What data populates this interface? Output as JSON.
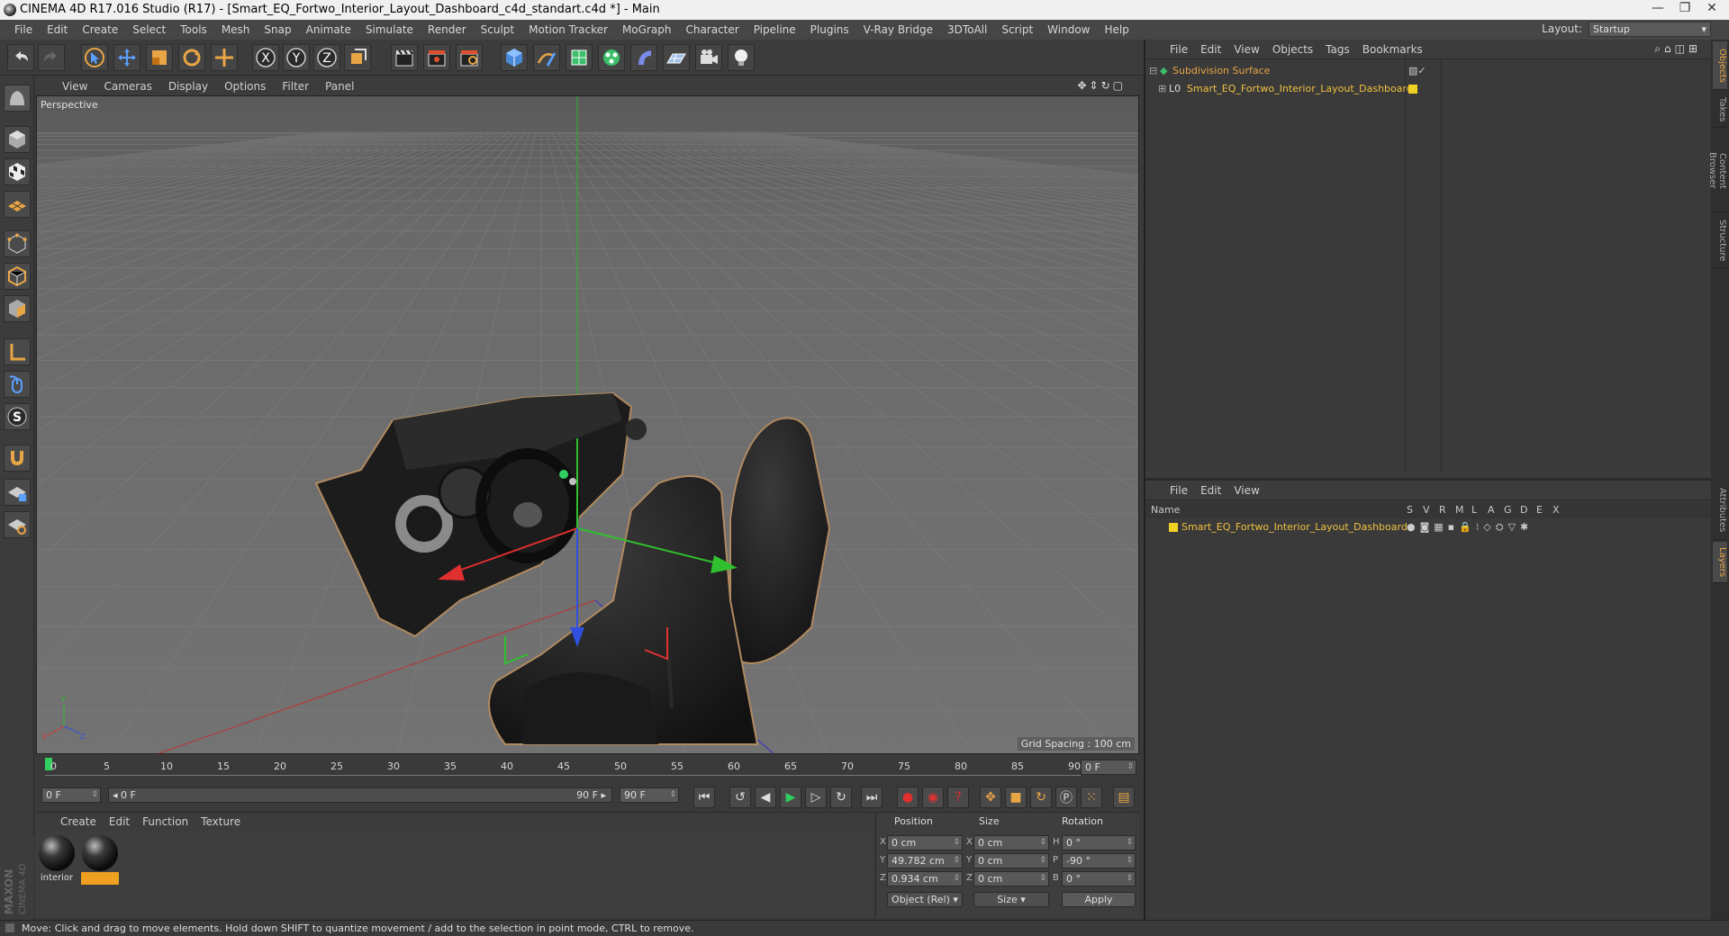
{
  "window": {
    "title": "CINEMA 4D R17.016 Studio (R17) - [Smart_EQ_Fortwo_Interior_Layout_Dashboard_c4d_standart.c4d *] - Main",
    "minimize": "—",
    "maximize": "❐",
    "close": "✕"
  },
  "menu": [
    "File",
    "Edit",
    "Create",
    "Select",
    "Tools",
    "Mesh",
    "Snap",
    "Animate",
    "Simulate",
    "Render",
    "Sculpt",
    "Motion Tracker",
    "MoGraph",
    "Character",
    "Pipeline",
    "Plugins",
    "V-Ray Bridge",
    "3DToAll",
    "Script",
    "Window",
    "Help"
  ],
  "layout": {
    "label": "Layout:",
    "value": "Startup"
  },
  "viewport": {
    "menu": [
      "View",
      "Cameras",
      "Display",
      "Options",
      "Filter",
      "Panel"
    ],
    "label": "Perspective",
    "grid_spacing": "Grid Spacing : 100 cm"
  },
  "timeline": {
    "ticks": [
      "0",
      "5",
      "10",
      "15",
      "20",
      "25",
      "30",
      "35",
      "40",
      "45",
      "50",
      "55",
      "60",
      "65",
      "70",
      "75",
      "80",
      "85",
      "90"
    ],
    "current_frame": "0 F"
  },
  "anim": {
    "start": "0 F",
    "range_start": "◂ 0 F",
    "range_end": "90 F ▸",
    "end": "90 F"
  },
  "materials": {
    "menu": [
      "Create",
      "Edit",
      "Function",
      "Texture"
    ],
    "items": [
      {
        "label": "interior"
      },
      {
        "label": ""
      }
    ]
  },
  "coords": {
    "headers": {
      "position": "Position",
      "size": "Size",
      "rotation": "Rotation"
    },
    "position": [
      {
        "axis": "X",
        "value": "0 cm"
      },
      {
        "axis": "Y",
        "value": "49.782 cm"
      },
      {
        "axis": "Z",
        "value": "0.934 cm"
      }
    ],
    "size": [
      {
        "axis": "X",
        "value": "0 cm"
      },
      {
        "axis": "Y",
        "value": "0 cm"
      },
      {
        "axis": "Z",
        "value": "0 cm"
      }
    ],
    "rotation": [
      {
        "axis": "H",
        "value": "0 °"
      },
      {
        "axis": "P",
        "value": "-90 °"
      },
      {
        "axis": "B",
        "value": "0 °"
      }
    ],
    "mode": "Object (Rel)",
    "size_mode": "Size",
    "apply": "Apply"
  },
  "objects": {
    "menu": [
      "File",
      "Edit",
      "View",
      "Objects",
      "Tags",
      "Bookmarks"
    ],
    "items": [
      {
        "name": "Subdivision Surface",
        "color": "#e8a545"
      },
      {
        "name": "Smart_EQ_Fortwo_Interior_Layout_Dashboard",
        "color": "#f0c040"
      }
    ]
  },
  "layers": {
    "menu": [
      "File",
      "Edit",
      "View"
    ],
    "name_header": "Name",
    "cols": [
      "S",
      "V",
      "R",
      "M",
      "L",
      "A",
      "G",
      "D",
      "E",
      "X"
    ],
    "items": [
      {
        "name": "Smart_EQ_Fortwo_Interior_Layout_Dashboard"
      }
    ]
  },
  "side_tabs": [
    "Objects",
    "Takes",
    "Content Browser",
    "Structure",
    "Attributes",
    "Layers"
  ],
  "status": "Move: Click and drag to move elements. Hold down SHIFT to quantize movement / add to the selection in point mode, CTRL to remove.",
  "brand": [
    "MAXON",
    "CINEMA 4D"
  ],
  "colors": {
    "accent": "#e8a545",
    "viewport_bg": "#6e6e6e",
    "panel_bg": "#3a3a3a"
  }
}
